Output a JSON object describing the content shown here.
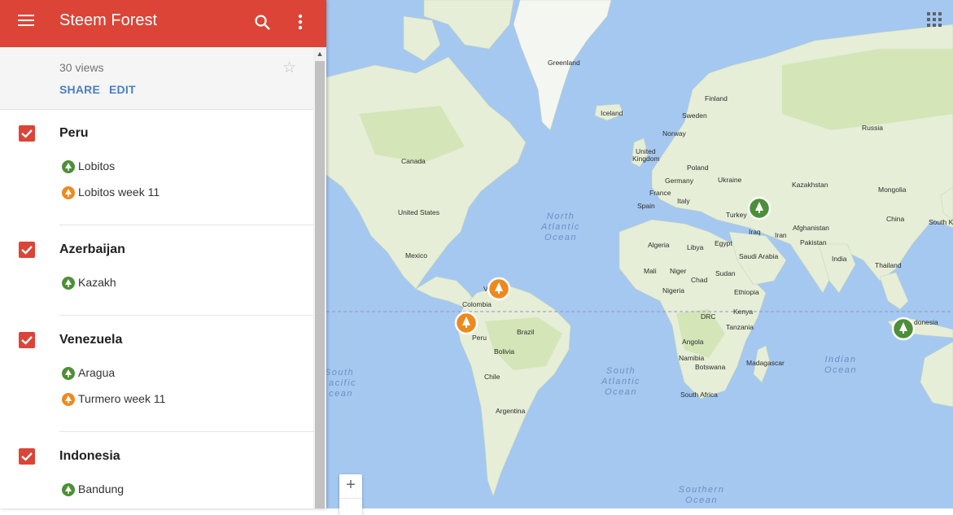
{
  "app": {
    "title": "Steem Forest",
    "views": "30 views",
    "share_label": "SHARE",
    "edit_label": "EDIT",
    "accent": "#db4437"
  },
  "icons": {
    "menu": "hamburger-menu-icon",
    "search": "search-icon",
    "more": "more-vert-icon",
    "star": "star-icon",
    "apps": "apps-grid-icon",
    "tree": "tree-icon",
    "check": "check-icon"
  },
  "groups": [
    {
      "title": "Peru",
      "checked": true,
      "items": [
        {
          "label": "Lobitos",
          "color": "#4d8f38"
        },
        {
          "label": "Lobitos week 11",
          "color": "#ec8a1e"
        }
      ]
    },
    {
      "title": "Azerbaijan",
      "checked": true,
      "items": [
        {
          "label": "Kazakh",
          "color": "#4d8f38"
        }
      ]
    },
    {
      "title": "Venezuela",
      "checked": true,
      "items": [
        {
          "label": "Aragua",
          "color": "#4d8f38"
        },
        {
          "label": "Turmero week 11",
          "color": "#ec8a1e"
        }
      ]
    },
    {
      "title": "Indonesia",
      "checked": true,
      "items": [
        {
          "label": "Bandung",
          "color": "#4d8f38"
        }
      ]
    }
  ],
  "map": {
    "zoom_in_label": "+",
    "labels": {
      "greenland": "Greenland",
      "iceland": "Iceland",
      "finland": "Finland",
      "sweden": "Sweden",
      "norway": "Norway",
      "russia": "Russia",
      "uk1": "United",
      "uk2": "Kingdom",
      "poland": "Poland",
      "ukraine": "Ukraine",
      "germany": "Germany",
      "france": "France",
      "italy": "Italy",
      "spain": "Spain",
      "turkey": "Turkey",
      "kazakhstan": "Kazakhstan",
      "mongolia": "Mongolia",
      "china": "China",
      "southk": "South K",
      "iraq": "Iraq",
      "iran": "Iran",
      "afghanistan": "Afghanistan",
      "pakistan": "Pakistan",
      "india": "India",
      "thailand": "Thailand",
      "canada": "Canada",
      "us": "United States",
      "mexico": "Mexico",
      "colombia": "Colombia",
      "venezuela": "Ve  zuela",
      "peru": "Peru",
      "brazil": "Brazil",
      "bolivia": "Bolivia",
      "chile": "Chile",
      "argentina": "Argentina",
      "algeria": "Algeria",
      "libya": "Libya",
      "egypt": "Egypt",
      "saudi": "Saudi Arabia",
      "mali": "Mali",
      "niger": "Niger",
      "chad": "Chad",
      "sudan": "Sudan",
      "nigeria": "Nigeria",
      "ethiopia": "Ethiopia",
      "drc": "DRC",
      "kenya": "Kenya",
      "tanzania": "Tanzania",
      "angola": "Angola",
      "namibia": "Namibia",
      "botswana": "Botswana",
      "madagascar": "Madagascar",
      "southafrica": "South Africa",
      "indonesia": "donesia",
      "north_atlantic_1": "North",
      "north_atlantic_2": "Atlantic",
      "north_atlantic_3": "Ocean",
      "south_pacific_1": "South",
      "south_pacific_2": "acific",
      "south_pacific_3": "cean",
      "south_atlantic_1": "South",
      "south_atlantic_2": "Atlantic",
      "south_atlantic_3": "Ocean",
      "indian_1": "Indian",
      "indian_2": "Ocean",
      "southern_1": "Southern",
      "southern_2": "Ocean"
    },
    "colors": {
      "water": "#a4c8f0",
      "land": "#e6eed7",
      "green": "#4d8f38",
      "orange": "#ec8a1e"
    }
  }
}
